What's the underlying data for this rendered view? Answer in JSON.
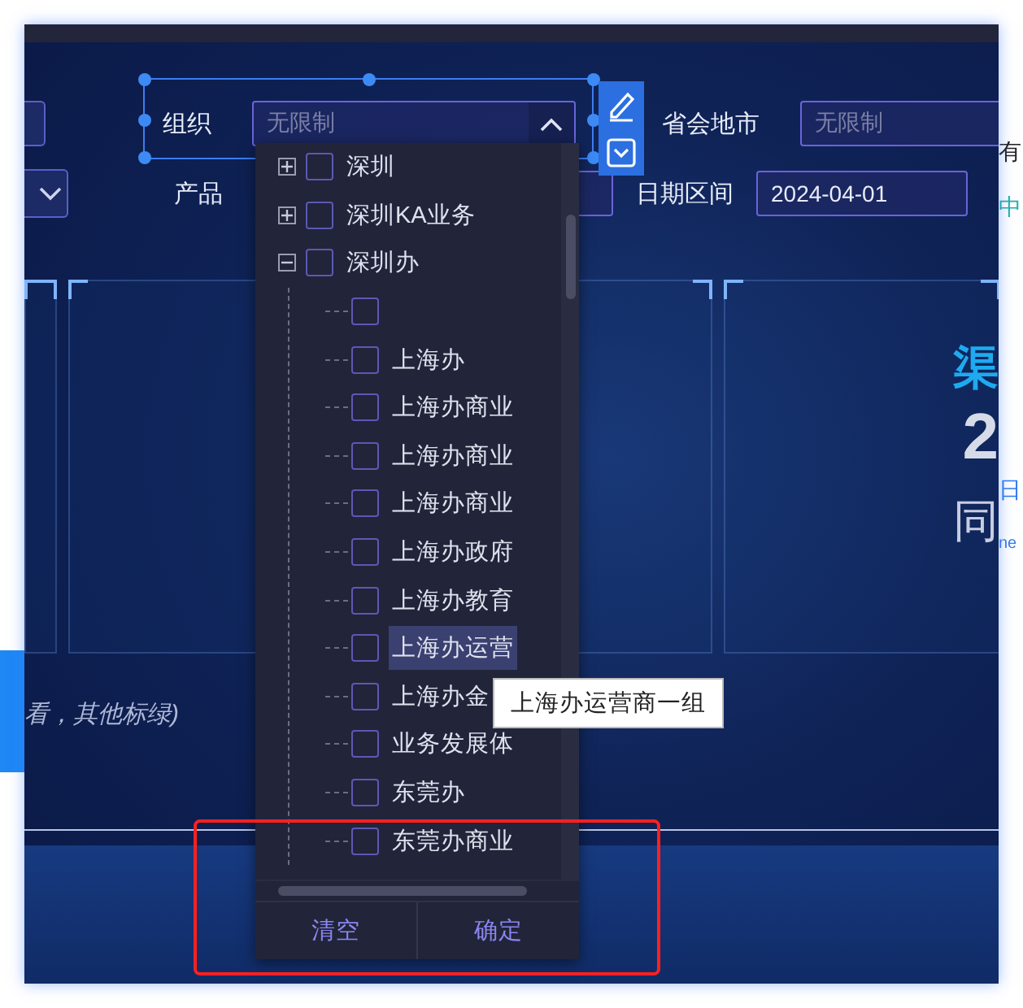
{
  "page_right_fragments": [
    "有",
    "中",
    "日",
    "ne"
  ],
  "filters": {
    "org": {
      "label": "组织",
      "placeholder": "无限制",
      "open": true
    },
    "city": {
      "label": "省会地市",
      "placeholder": "无限制"
    },
    "product": {
      "label": "产品"
    },
    "date": {
      "label": "日期区间",
      "value": "2024-04-01"
    }
  },
  "card": {
    "title": "渠",
    "value": "2",
    "subtitle": "同"
  },
  "note": "看，其他标绿)",
  "tree": [
    {
      "label": "深圳",
      "expanded": false,
      "checked": false
    },
    {
      "label": "深圳KA业务",
      "expanded": false,
      "checked": false
    },
    {
      "label": "深圳办",
      "expanded": true,
      "checked": false,
      "children": [
        {
          "checked": false,
          "hovered": false
        },
        {
          "label": "上海办",
          "checked": false,
          "hovered": false
        },
        {
          "label": "上海办商业",
          "checked": false,
          "hovered": false
        },
        {
          "label": "上海办商业",
          "checked": false,
          "hovered": false
        },
        {
          "label": "上海办商业",
          "checked": false,
          "hovered": false
        },
        {
          "label": "上海办政府",
          "checked": false,
          "hovered": false
        },
        {
          "label": "上海办教育",
          "checked": false,
          "hovered": false
        },
        {
          "label": "上海办运营",
          "checked": false,
          "hovered": true
        },
        {
          "label": "上海办金",
          "checked": false,
          "hovered": false
        },
        {
          "label": "业务发展体",
          "checked": false,
          "hovered": false
        },
        {
          "label": "东莞办",
          "checked": false,
          "hovered": false
        },
        {
          "label": "东莞办商业",
          "checked": false,
          "hovered": false
        }
      ]
    }
  ],
  "popup_buttons": [
    "清空",
    "确定"
  ],
  "tooltip": "上海办运营商一组"
}
